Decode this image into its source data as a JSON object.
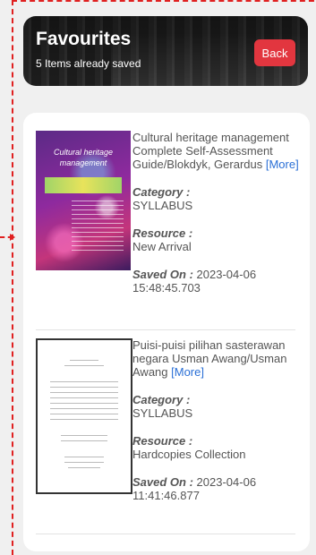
{
  "header": {
    "title": "Favourites",
    "subtitle": "5 Items already saved",
    "back_label": "Back"
  },
  "items": [
    {
      "cover_text": "Cultural heritage management",
      "title": "Cultural heritage management Complete Self-Assessment Guide/Blokdyk, Gerardus",
      "more": "[More]",
      "category_label": "Category :",
      "category": "SYLLABUS",
      "resource_label": "Resource :",
      "resource": "New Arrival",
      "saved_label": "Saved On :",
      "saved_date": "2023-04-06",
      "saved_time": "15:48:45.703"
    },
    {
      "title": "Puisi-puisi pilihan sasterawan negara Usman Awang/Usman Awang",
      "more": "[More]",
      "category_label": "Category :",
      "category": "SYLLABUS",
      "resource_label": "Resource :",
      "resource": "Hardcopies Collection",
      "saved_label": "Saved On :",
      "saved_date": "2023-04-06",
      "saved_time": "11:41:46.877"
    }
  ]
}
